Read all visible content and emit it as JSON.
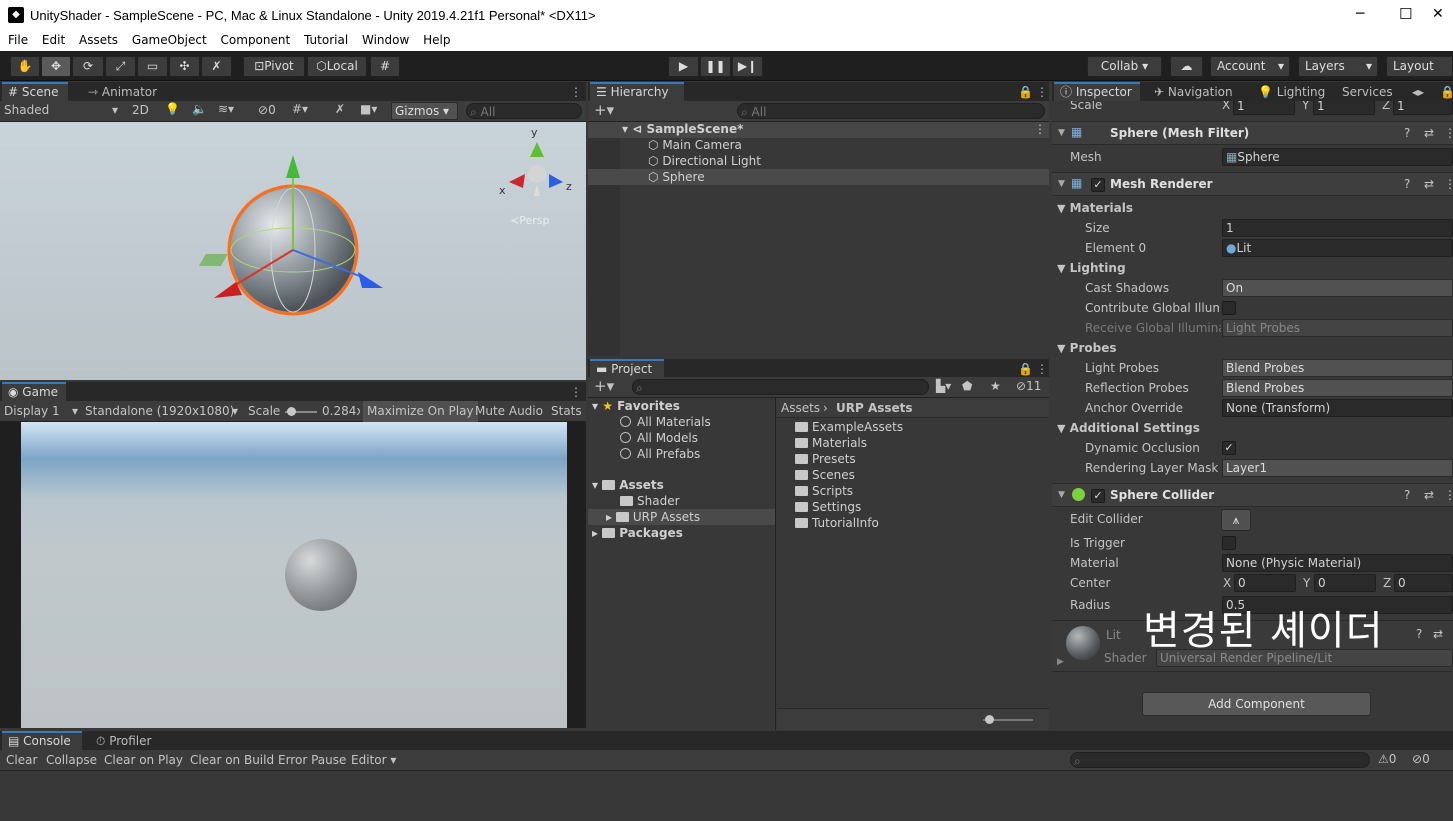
{
  "window": {
    "title": "UnityShader - SampleScene - PC, Mac & Linux Standalone - Unity 2019.4.21f1 Personal* <DX11>",
    "min": "─",
    "max": "☐",
    "close": "✕"
  },
  "menu": [
    "File",
    "Edit",
    "Assets",
    "GameObject",
    "Component",
    "Tutorial",
    "Window",
    "Help"
  ],
  "toolbar": {
    "pivot": "Pivot",
    "local": "Local",
    "collab": "Collab ▾",
    "account": "Account",
    "layers": "Layers",
    "layout": "Layout"
  },
  "scene": {
    "tab": "Scene",
    "tab2": "Animator",
    "shading": "Shaded",
    "mode2d": "2D",
    "hidden_count": "0",
    "gizmos": "Gizmos",
    "search_placeholder": "All",
    "persp": "≺Persp",
    "axis_y": "y",
    "axis_x": "x",
    "axis_z": "z"
  },
  "game": {
    "tab": "Game",
    "display": "Display 1",
    "resolution": "Standalone (1920x1080)",
    "scale_label": "Scale",
    "scale_value": "0.284x",
    "scale_level": 0.1,
    "maximize": "Maximize On Play",
    "mute": "Mute Audio",
    "stats": "Stats"
  },
  "hierarchy": {
    "tab": "Hierarchy",
    "search_placeholder": "All",
    "scene": "SampleScene*",
    "items": [
      "Main Camera",
      "Directional Light",
      "Sphere"
    ]
  },
  "project": {
    "tab": "Project",
    "hidden_count": "11",
    "favorites": "Favorites",
    "fav_items": [
      "All Materials",
      "All Models",
      "All Prefabs"
    ],
    "assets": "Assets",
    "asset_items": [
      "Shader",
      "URP Assets"
    ],
    "packages": "Packages",
    "breadcrumb_root": "Assets",
    "breadcrumb_sep": "›",
    "breadcrumb_current": "URP Assets",
    "folders": [
      "ExampleAssets",
      "Materials",
      "Presets",
      "Scenes",
      "Scripts",
      "Settings",
      "TutorialInfo"
    ],
    "zoom_level": 0.05
  },
  "inspector": {
    "tabs": [
      "Inspector",
      "Navigation",
      "Lighting",
      "Services"
    ],
    "scale": {
      "label": "Scale",
      "x": "1",
      "y": "1",
      "z": "1"
    },
    "mesh_filter": {
      "title": "Sphere (Mesh Filter)",
      "mesh_label": "Mesh",
      "mesh_value": "Sphere"
    },
    "mesh_renderer": {
      "title": "Mesh Renderer",
      "materials": "Materials",
      "size_label": "Size",
      "size_value": "1",
      "element_label": "Element 0",
      "element_value": "Lit",
      "lighting": "Lighting",
      "cast_label": "Cast Shadows",
      "cast_value": "On",
      "contrib_label": "Contribute Global Illumir",
      "receive_label": "Receive Global Illuminat",
      "receive_value": "Light Probes",
      "probes": "Probes",
      "light_probes_label": "Light Probes",
      "light_probes_value": "Blend Probes",
      "refl_label": "Reflection Probes",
      "refl_value": "Blend Probes",
      "anchor_label": "Anchor Override",
      "anchor_value": "None (Transform)",
      "additional": "Additional Settings",
      "dyn_label": "Dynamic Occlusion",
      "layer_label": "Rendering Layer Mask",
      "layer_value": "Layer1"
    },
    "sphere_collider": {
      "title": "Sphere Collider",
      "edit_label": "Edit Collider",
      "trigger_label": "Is Trigger",
      "material_label": "Material",
      "material_value": "None (Physic Material)",
      "center_label": "Center",
      "cx": "0",
      "cy": "0",
      "cz": "0",
      "radius_label": "Radius",
      "radius_value": "0.5"
    },
    "material": {
      "name": "Lit",
      "shader_label": "Shader",
      "shader_value": "Universal Render Pipeline/Lit"
    },
    "overlay": "변경된 셰이더",
    "add_component": "Add Component"
  },
  "console": {
    "tab": "Console",
    "tab2": "Profiler",
    "buttons": [
      "Clear",
      "Collapse",
      "Clear on Play",
      "Clear on Build",
      "Error Pause",
      "Editor ▾"
    ],
    "warn_count": "0",
    "err_count": "0"
  }
}
